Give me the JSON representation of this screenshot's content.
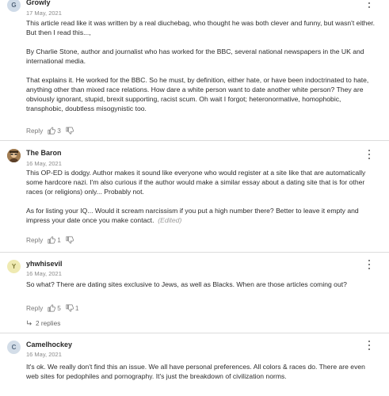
{
  "comments": [
    {
      "avatar_letter": "G",
      "author": "Growly",
      "date": "17 May, 2021",
      "paragraphs": [
        "This article read like it was written by a real diuchebag, who thought he was both clever and funny, but wasn't either. But then I read this...,",
        "By Charlie Stone, author and journalist who has worked for the BBC, several national newspapers in the UK and international media.",
        "That explains it. He worked for the BBC. So he must, by definition, either hate, or have been indoctrinated to hate, anything other than mixed race relations. How dare a white person want to date another white person? They are obviously ignorant, stupid,  brexit supporting, racist scum. Oh wait I forgot; heteronormative, homophobic, transphobic, doubtless misogynistic too."
      ],
      "reply_label": "Reply",
      "likes": "3",
      "dislikes": ""
    },
    {
      "avatar_letter": "",
      "author": "The Baron",
      "date": "16 May, 2021",
      "paragraphs": [
        "This OP-ED is dodgy. Author makes it sound like everyone who would register at a site like that are automatically some hardcore nazi. I'm also curious if the author would make a similar essay about a dating site that is for other races (or religions) only... Probably not.",
        "As for listing your IQ... Would it scream narcissism if you put a high number there? Better to leave it empty and impress your date once you make contact."
      ],
      "edited": "(Edited)",
      "reply_label": "Reply",
      "likes": "1",
      "dislikes": ""
    },
    {
      "avatar_letter": "Y",
      "author": "yhwhisevil",
      "date": "16 May, 2021",
      "paragraphs": [
        "So what? There are dating sites exclusive to Jews, as well as Blacks. When are those articles coming out?"
      ],
      "reply_label": "Reply",
      "likes": "5",
      "dislikes": "1",
      "replies_label": "2 replies"
    },
    {
      "avatar_letter": "C",
      "author": "Camelhockey",
      "date": "16 May, 2021",
      "paragraphs": [
        "It's ok. We really don't find this an issue. We all have personal preferences. All colors & races do. There are even web sites for pedophiles and pornography. It's just the breakdown of civilization norms."
      ]
    }
  ],
  "colors": {
    "divider": "#dcdcdc",
    "muted": "#8a8a8a",
    "avatar_g": "#cfdbe8",
    "avatar_y": "#efeab2",
    "avatar_c": "#d3dde8"
  },
  "icons": [
    "thumbs-up-icon",
    "thumbs-down-icon",
    "more-vertical-icon",
    "reply-arrow-icon",
    "avatar-photo-icon"
  ]
}
